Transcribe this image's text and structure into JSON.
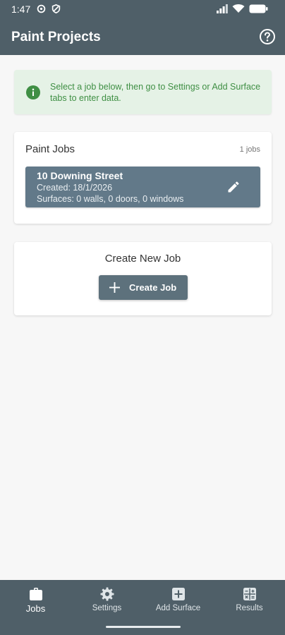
{
  "status_bar": {
    "time": "1:47"
  },
  "app_bar": {
    "title": "Paint Projects",
    "help_icon": "help-circle-icon"
  },
  "info_banner": {
    "icon": "info-icon",
    "text": "Select a job below, then go to Settings or Add Surface tabs to enter data.",
    "color": "#3f8f44"
  },
  "jobs_section": {
    "title": "Paint Jobs",
    "count": "1 jobs",
    "jobs": [
      {
        "name": "10 Downing Street",
        "created": "Created: 18/1/2026",
        "surfaces": "Surfaces: 0 walls, 0 doors, 0 windows",
        "edit_icon": "pencil-icon"
      }
    ]
  },
  "create_section": {
    "title": "Create New Job",
    "button_label": "Create Job",
    "button_icon": "plus-icon"
  },
  "bottom_nav": {
    "items": [
      {
        "label": "Jobs",
        "icon": "briefcase-icon",
        "active": true
      },
      {
        "label": "Settings",
        "icon": "gear-icon",
        "active": false
      },
      {
        "label": "Add Surface",
        "icon": "plus-box-icon",
        "active": false
      },
      {
        "label": "Results",
        "icon": "calculator-icon",
        "active": false
      }
    ]
  },
  "colors": {
    "primary": "#4f5f68",
    "job_card": "#627989",
    "info_bg": "#e5f2e6"
  }
}
